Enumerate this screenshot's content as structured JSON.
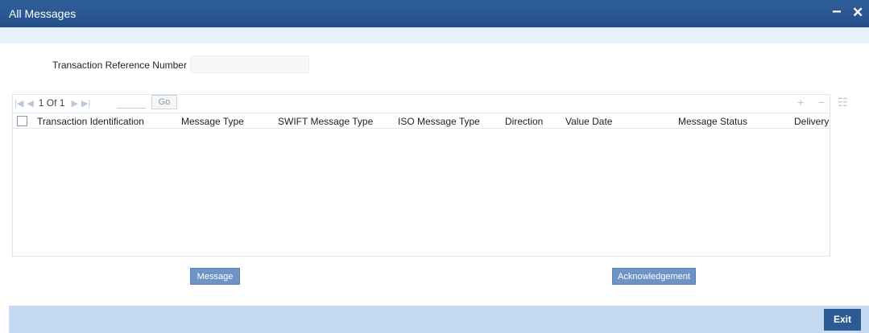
{
  "window": {
    "title": "All Messages",
    "minimize_label": "−",
    "close_label": "✕"
  },
  "form": {
    "trn_label": "Transaction Reference Number",
    "trn_value": ""
  },
  "pager": {
    "first_icon": "first-page-icon",
    "prev_icon": "prev-page-icon",
    "page_info": "1 Of 1",
    "next_icon": "next-page-icon",
    "last_icon": "last-page-icon",
    "go_label": "Go"
  },
  "grid": {
    "tools": {
      "add": "+",
      "delete": "−",
      "columns": "☷"
    },
    "columns": [
      "Transaction Identification",
      "Message Type",
      "SWIFT Message Type",
      "ISO Message Type",
      "Direction",
      "Value Date",
      "Message Status",
      "Delivery Status"
    ],
    "rows": []
  },
  "actions": {
    "message_label": "Message",
    "ack_label": "Acknowledgement"
  },
  "footer": {
    "exit_label": "Exit"
  },
  "colors": {
    "titlebar": "#2a5891",
    "button": "#6d94c5",
    "footer": "#c5daf0",
    "exit": "#2b5a95"
  }
}
